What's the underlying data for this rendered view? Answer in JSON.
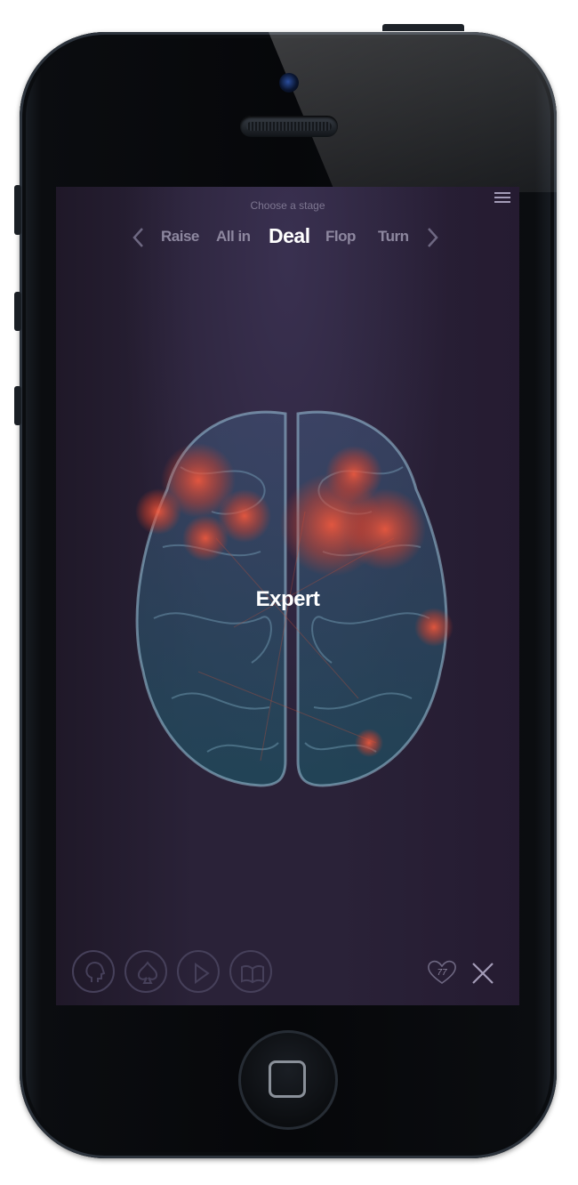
{
  "screen": {
    "header": {
      "title": "Choose a stage",
      "menu_icon": "hamburger-menu-icon"
    },
    "stages": {
      "items": [
        "Raise",
        "All in",
        "Deal",
        "Flop",
        "Turn"
      ],
      "active": "Deal"
    },
    "brain": {
      "icon": "brain-heatmap-illustration",
      "level_label": "Expert"
    },
    "toolbar": {
      "buttons": [
        "head-profile-icon",
        "spade-icon",
        "play-icon",
        "book-icon"
      ],
      "lives_icon": "heart-icon",
      "lives_value": "77",
      "close_icon": "close-icon"
    }
  },
  "colors": {
    "background": "#2a2238",
    "accent_red": "#e8462e",
    "brain_blue": "#6fa7c8",
    "inactive_text": "#8d879f"
  }
}
